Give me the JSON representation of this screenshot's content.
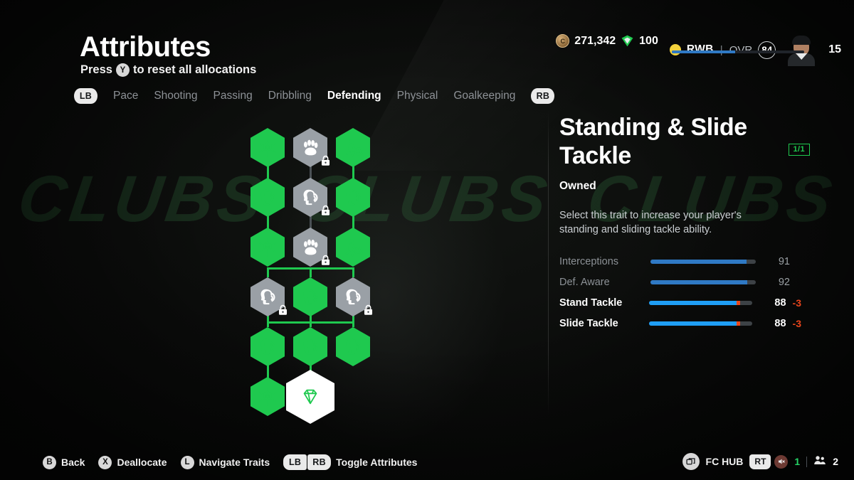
{
  "header": {
    "title": "Attributes",
    "reset_hint_prefix": "Press",
    "reset_button": "Y",
    "reset_hint_suffix": "to reset all allocations"
  },
  "tabs": {
    "left_bumper": "LB",
    "right_bumper": "RB",
    "items": [
      {
        "label": "Pace",
        "active": false
      },
      {
        "label": "Shooting",
        "active": false
      },
      {
        "label": "Passing",
        "active": false
      },
      {
        "label": "Dribbling",
        "active": false
      },
      {
        "label": "Defending",
        "active": true
      },
      {
        "label": "Physical",
        "active": false
      },
      {
        "label": "Goalkeeping",
        "active": false
      }
    ]
  },
  "hud": {
    "coins": "271,342",
    "points": "100",
    "position": "RWB",
    "separator": "|",
    "ovr_label": "OVR",
    "ovr_value": "84",
    "level": "15",
    "progress_percent": 48,
    "coin_icon": "coin-icon",
    "points_icon": "points-shield-icon",
    "accent_blue": "#2f79c4",
    "dot_color": "#f4d23c"
  },
  "panel": {
    "trait_title": "Standing & Slide Tackle",
    "count_badge": "1/1",
    "status": "Owned",
    "description": "Select this trait to increase your player's standing and sliding tackle ability.",
    "accent_green": "#1fc94f",
    "stats": [
      {
        "name": "Interceptions",
        "value": "91",
        "fill": 91,
        "delta": 0,
        "delta_label": "",
        "highlight": false
      },
      {
        "name": "Def. Aware",
        "value": "92",
        "fill": 92,
        "delta": 0,
        "delta_label": "",
        "highlight": false
      },
      {
        "name": "Stand Tackle",
        "value": "88",
        "fill": 85,
        "delta": 3,
        "delta_label": "-3",
        "highlight": true
      },
      {
        "name": "Slide Tackle",
        "value": "88",
        "fill": 85,
        "delta": 3,
        "delta_label": "-3",
        "highlight": true
      }
    ]
  },
  "tree": {
    "nodes": [
      {
        "id": "n0",
        "col": 0,
        "row": 0,
        "icon": "web-icon",
        "state": "owned",
        "selected": false
      },
      {
        "id": "n1",
        "col": 1,
        "row": 0,
        "icon": "paw-icon",
        "state": "locked",
        "selected": false
      },
      {
        "id": "n2",
        "col": 2,
        "row": 0,
        "icon": "tackle-icon",
        "state": "owned",
        "selected": false
      },
      {
        "id": "n3",
        "col": 0,
        "row": 1,
        "icon": "aware-icon",
        "state": "owned",
        "selected": false
      },
      {
        "id": "n4",
        "col": 1,
        "row": 1,
        "icon": "aware-icon",
        "state": "locked",
        "selected": false
      },
      {
        "id": "n5",
        "col": 2,
        "row": 1,
        "icon": "aware-icon",
        "state": "owned",
        "selected": false
      },
      {
        "id": "n6",
        "col": 0,
        "row": 2,
        "icon": "web-icon",
        "state": "owned",
        "selected": false
      },
      {
        "id": "n7",
        "col": 1,
        "row": 2,
        "icon": "paw-icon",
        "state": "locked",
        "selected": false
      },
      {
        "id": "n8",
        "col": 2,
        "row": 2,
        "icon": "tackle-icon",
        "state": "owned",
        "selected": false
      },
      {
        "id": "n9",
        "col": 0,
        "row": 3,
        "icon": "aware-icon",
        "state": "locked",
        "selected": false
      },
      {
        "id": "n10",
        "col": 1,
        "row": 3,
        "icon": "aware-icon",
        "state": "owned",
        "selected": false
      },
      {
        "id": "n11",
        "col": 2,
        "row": 3,
        "icon": "aware-icon",
        "state": "locked",
        "selected": false
      },
      {
        "id": "n12",
        "col": 0,
        "row": 4,
        "icon": "aware-icon",
        "state": "owned",
        "selected": false
      },
      {
        "id": "n13",
        "col": 1,
        "row": 4,
        "icon": "aware-icon",
        "state": "owned",
        "selected": false
      },
      {
        "id": "n14",
        "col": 2,
        "row": 4,
        "icon": "aware-icon",
        "state": "owned",
        "selected": false
      },
      {
        "id": "n15",
        "col": 0,
        "row": 5,
        "icon": "web-icon",
        "state": "owned",
        "selected": false
      },
      {
        "id": "n16",
        "col": 1,
        "row": 5,
        "icon": "gem-icon",
        "state": "owned",
        "selected": true
      }
    ]
  },
  "footer": {
    "left": [
      {
        "key": "B",
        "key_type": "round",
        "label": "Back"
      },
      {
        "key": "X",
        "key_type": "round",
        "label": "Deallocate"
      },
      {
        "key": "L",
        "key_type": "round",
        "label": "Navigate Traits"
      },
      {
        "key": "LB RB",
        "key_type": "bumper-pair",
        "label": "Toggle Attributes"
      }
    ],
    "right": {
      "hub_label": "FC HUB",
      "hub_icon": "windows-icon",
      "rt_key": "RT",
      "mute_icon": "muted-speaker-icon",
      "voice_count": "1",
      "party_icon": "people-icon",
      "party_count": "2"
    }
  },
  "background": {
    "watermark_text": "CLUBS"
  }
}
